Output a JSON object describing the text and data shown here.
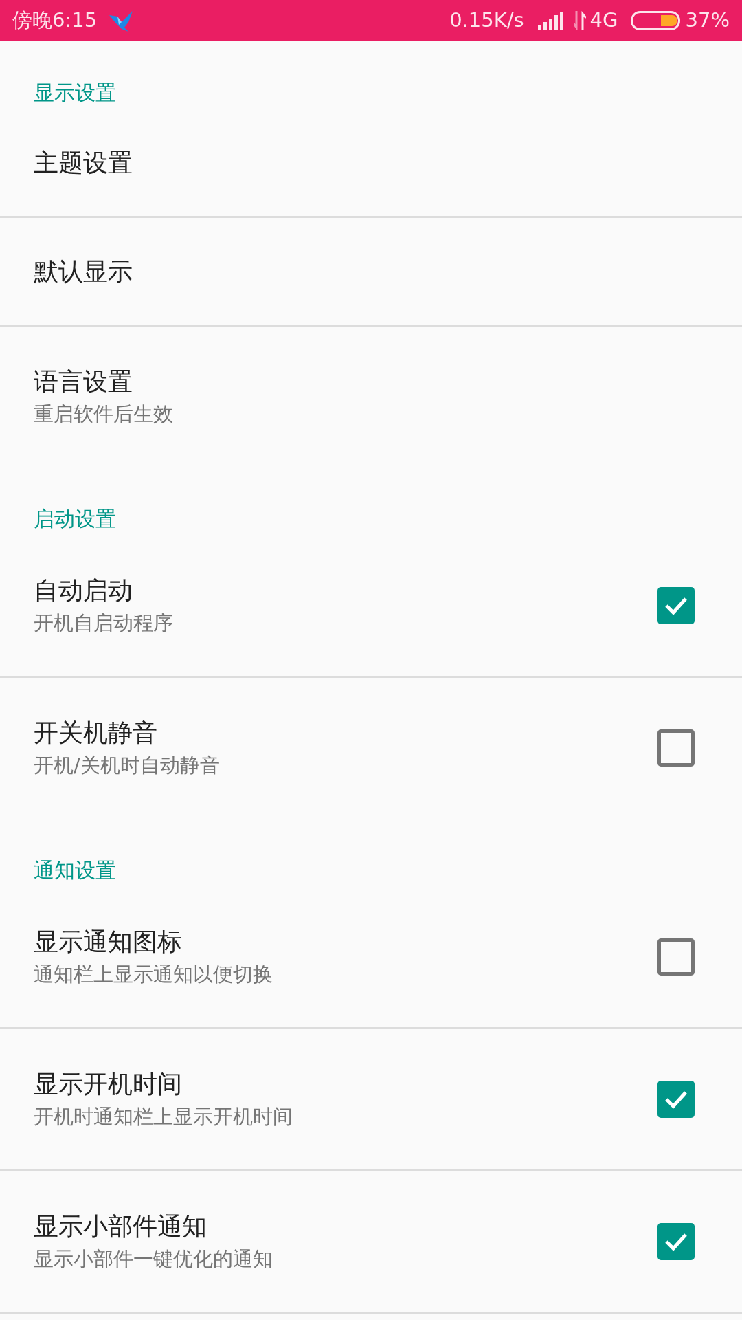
{
  "status_bar": {
    "time": "傍晚6:15",
    "network_speed": "0.15K/s",
    "network_type": "4G",
    "battery": "37%"
  },
  "sections": [
    {
      "title": "显示设置",
      "items": [
        {
          "kind": "link",
          "title": "主题设置"
        },
        {
          "kind": "link",
          "title": "默认显示"
        },
        {
          "kind": "link",
          "title": "语言设置",
          "subtitle": "重启软件后生效"
        }
      ]
    },
    {
      "title": "启动设置",
      "items": [
        {
          "kind": "checkbox",
          "title": "自动启动",
          "subtitle": "开机自启动程序",
          "checked": true
        },
        {
          "kind": "checkbox",
          "title": "开关机静音",
          "subtitle": "开机/关机时自动静音",
          "checked": false
        }
      ]
    },
    {
      "title": "通知设置",
      "items": [
        {
          "kind": "checkbox",
          "title": "显示通知图标",
          "subtitle": "通知栏上显示通知以便切换",
          "checked": false
        },
        {
          "kind": "checkbox",
          "title": "显示开机时间",
          "subtitle": "开机时通知栏上显示开机时间",
          "checked": true
        },
        {
          "kind": "checkbox",
          "title": "显示小部件通知",
          "subtitle": "显示小部件一键优化的通知",
          "checked": true
        }
      ]
    }
  ]
}
